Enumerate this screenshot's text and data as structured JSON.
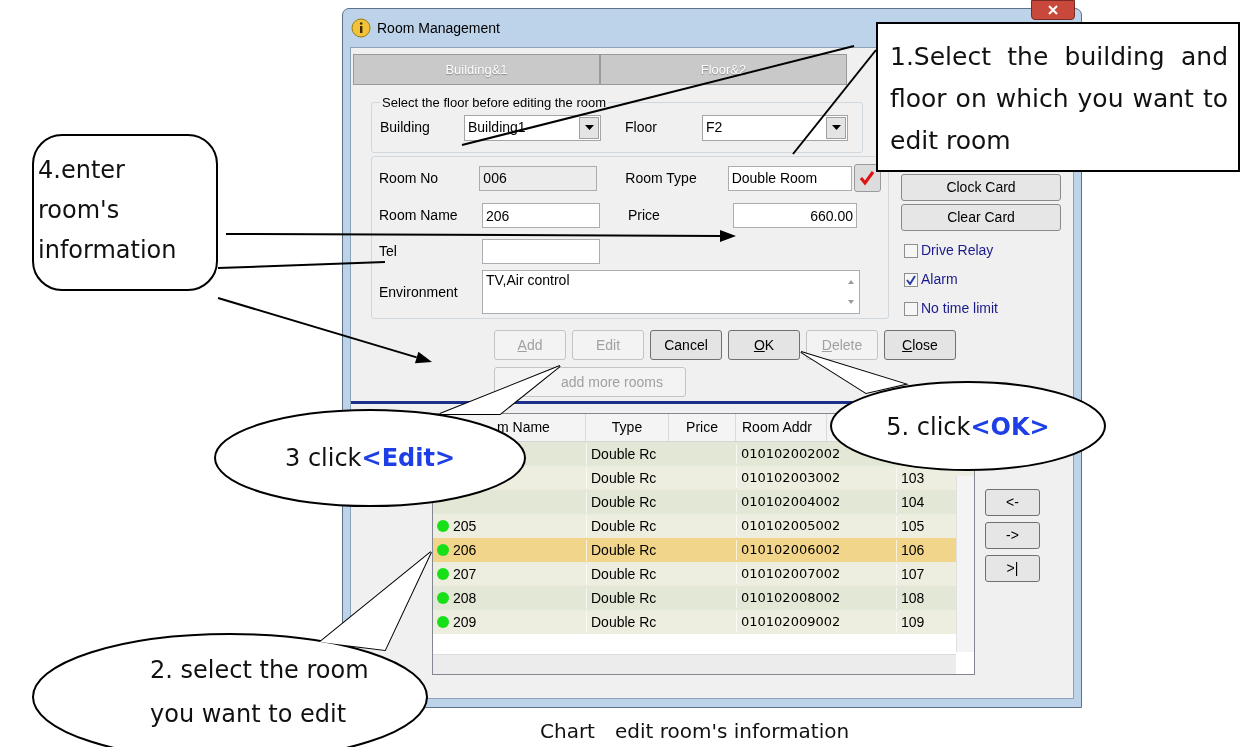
{
  "window": {
    "title": "Room Management"
  },
  "tabs": [
    {
      "label": "Building&1",
      "disabled": true
    },
    {
      "label": "Floor&2",
      "disabled": true
    }
  ],
  "floor_selector": {
    "caption": "Select the floor before editing the room",
    "building_label": "Building",
    "building": "Building1",
    "floor_label": "Floor",
    "floor": "F2"
  },
  "room_form": {
    "room_no": {
      "label": "Room No",
      "value": "006",
      "disabled": true
    },
    "room_type": {
      "label": "Room Type",
      "value": "Double Room"
    },
    "room_name": {
      "label": "Room Name",
      "value": "206"
    },
    "price": {
      "label": "Price",
      "value": "660.00"
    },
    "tel": {
      "label": "Tel"
    },
    "environment": {
      "label": "Environment",
      "value": "TV,Air control"
    }
  },
  "card_buttons": [
    "Clock Card",
    "Clear Card"
  ],
  "options": [
    {
      "label": "Drive Relay",
      "checked": false
    },
    {
      "label": "Alarm",
      "checked": true
    },
    {
      "label": "No time limit",
      "checked": false
    }
  ],
  "actions": [
    {
      "label": "Add",
      "underline_first": true,
      "disabled": true
    },
    {
      "label": "Edit",
      "underline_first": false,
      "disabled": true
    },
    {
      "label": "Cancel",
      "underline_first": false,
      "disabled": false
    },
    {
      "label": "OK",
      "underline_first": true,
      "disabled": false
    },
    {
      "label": "Delete",
      "underline_first": true,
      "disabled": true
    },
    {
      "label": "Close",
      "underline_first": true,
      "disabled": false
    }
  ],
  "quick_add": {
    "label": "add more rooms",
    "disabled": true
  },
  "table": {
    "columns": [
      "m Name",
      "Type",
      "Price",
      "Room Addr"
    ],
    "rows": [
      {
        "type": "Double Rc",
        "address": "010102002002",
        "selected": false
      },
      {
        "type": "Double Rc",
        "address": "010102003002",
        "column_6": "103",
        "selected": false
      },
      {
        "type": "Double Rc",
        "address": "010102004002",
        "column_6": "104",
        "selected": false
      },
      {
        "name": "205",
        "online": true,
        "type": "Double Rc",
        "address": "010102005002",
        "column_6": "105",
        "selected": false
      },
      {
        "name": "206",
        "online": true,
        "type": "Double Rc",
        "address": "010102006002",
        "column_6": "106",
        "selected": true
      },
      {
        "name": "207",
        "online": true,
        "type": "Double Rc",
        "address": "010102007002",
        "column_6": "107",
        "selected": false
      },
      {
        "name": "208",
        "online": true,
        "type": "Double Rc",
        "address": "010102008002",
        "column_6": "108",
        "selected": false
      },
      {
        "name": "209",
        "online": true,
        "type": "Double Rc",
        "address": "010102009002",
        "column_6": "109",
        "selected": false
      }
    ]
  },
  "nav_buttons": [
    "<-",
    "->",
    ">|"
  ],
  "callouts": [
    {
      "kind": "box",
      "text": "1.Select the building and floor on which you want to edit room"
    },
    {
      "kind": "note",
      "text": "4.enter room's information"
    },
    {
      "kind": "bubble",
      "text": "3 click",
      "emphasis": "<Edit>"
    },
    {
      "kind": "bubble",
      "text": "5. click",
      "emphasis": "<OK>"
    },
    {
      "kind": "bubble",
      "text": "2. select the room you want to edit"
    }
  ],
  "caption": "Chart　edit room's information"
}
